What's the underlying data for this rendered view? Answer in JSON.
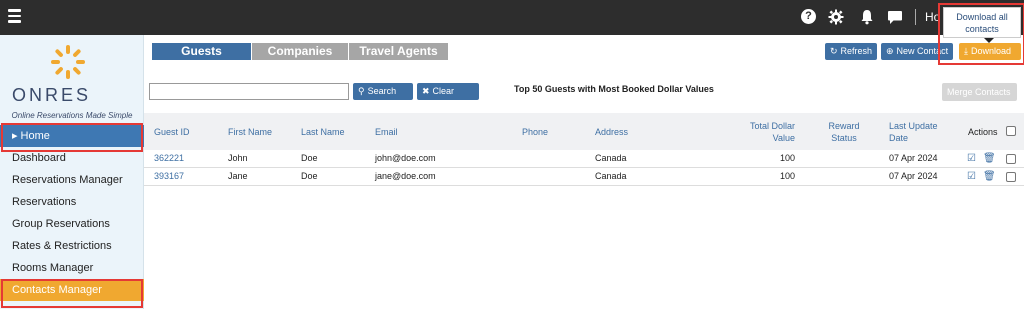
{
  "topbar": {
    "user": "Ho",
    "help_symbol": "?",
    "tooltip": "Download all contacts"
  },
  "logo": {
    "brand": "ONRES",
    "tagline": "Online Reservations Made Simple"
  },
  "sidebar": {
    "items": [
      {
        "label": "Home"
      },
      {
        "label": "Dashboard"
      },
      {
        "label": "Reservations Manager"
      },
      {
        "label": "Reservations"
      },
      {
        "label": "Group Reservations"
      },
      {
        "label": "Rates & Restrictions"
      },
      {
        "label": "Rooms Manager"
      },
      {
        "label": "Contacts Manager"
      }
    ]
  },
  "tabs": [
    {
      "label": "Guests"
    },
    {
      "label": "Companies"
    },
    {
      "label": "Travel Agents"
    }
  ],
  "toolbar": {
    "refresh": "Refresh",
    "new_contact": "New Contact",
    "download": "Download"
  },
  "search": {
    "placeholder": "",
    "search_label": "Search",
    "clear_label": "Clear"
  },
  "report_title": "Top 50 Guests with Most Booked Dollar Values",
  "merge_label": "Merge Contacts",
  "table": {
    "columns": {
      "guest_id": "Guest ID",
      "first_name": "First Name",
      "last_name": "Last Name",
      "email": "Email",
      "phone": "Phone",
      "address": "Address",
      "total_1": "Total Dollar",
      "total_2": "Value",
      "reward_1": "Reward",
      "reward_2": "Status",
      "update_1": "Last Update",
      "update_2": "Date",
      "actions": "Actions"
    },
    "rows": [
      {
        "guest_id": "362221",
        "first_name": "John",
        "last_name": "Doe",
        "email": "john@doe.com",
        "phone": "",
        "address": "Canada",
        "total": "100",
        "reward": "",
        "date": "07 Apr 2024"
      },
      {
        "guest_id": "393167",
        "first_name": "Jane",
        "last_name": "Doe",
        "email": "jane@doe.com",
        "phone": "",
        "address": "Canada",
        "total": "100",
        "reward": "",
        "date": "07 Apr 2024"
      }
    ]
  },
  "colors": {
    "topbar": "#2d2d2d",
    "primary": "#3e6fa3",
    "accent": "#f0a830",
    "highlight": "#e53935",
    "sidebar": "#ebf4fa"
  }
}
